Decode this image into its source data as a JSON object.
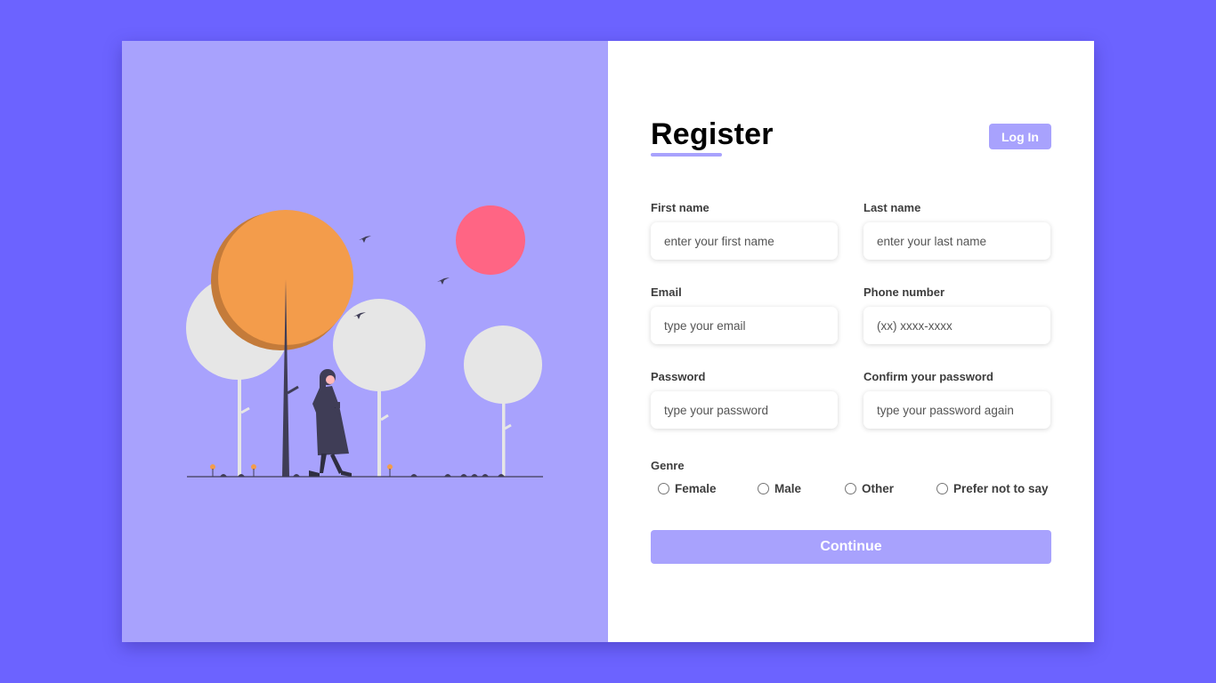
{
  "colors": {
    "page_bg": "#6c63ff",
    "accent": "#a8a2fd",
    "tree_orange": "#f39c4b",
    "sun": "#ff6584",
    "tree_white": "#e6e6e6",
    "ink": "#3f3d56"
  },
  "illustration": {
    "name": "woman-walking-in-park-illustration"
  },
  "form": {
    "title": "Register",
    "login_label": "Log In",
    "fields": [
      {
        "label": "First name",
        "placeholder": "enter your first name"
      },
      {
        "label": "Last name",
        "placeholder": "enter your last name"
      },
      {
        "label": "Email",
        "placeholder": "type your email"
      },
      {
        "label": "Phone number",
        "placeholder": "(xx) xxxx-xxxx"
      },
      {
        "label": "Password",
        "placeholder": "type your password"
      },
      {
        "label": "Confirm your password",
        "placeholder": "type your password again"
      }
    ],
    "genre": {
      "label": "Genre",
      "options": [
        "Female",
        "Male",
        "Other",
        "Prefer not to say"
      ]
    },
    "continue_label": "Continue"
  }
}
